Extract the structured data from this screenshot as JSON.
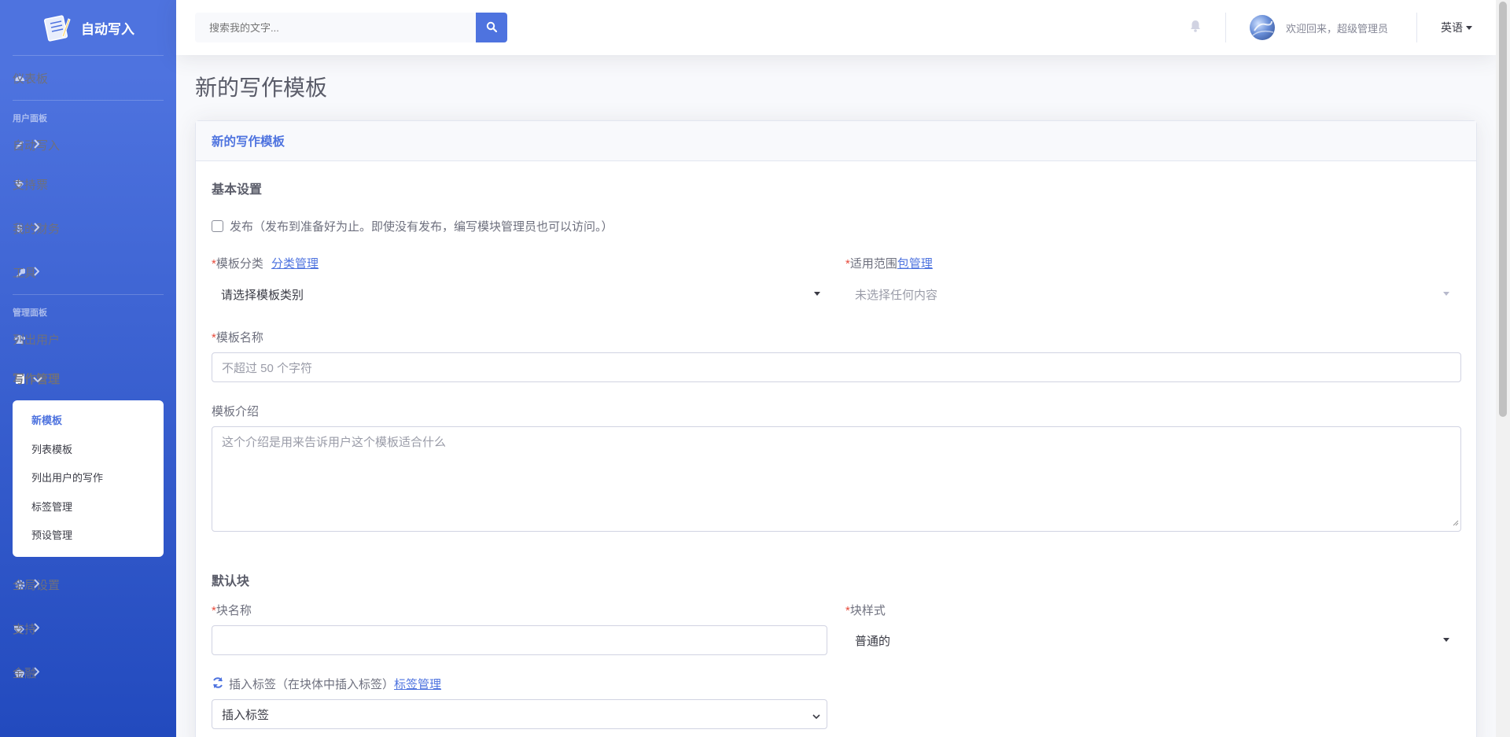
{
  "brand": {
    "name": "自动写入"
  },
  "sidebar": {
    "dashboard": "仪表板",
    "heading_user": "用户面板",
    "auto_write": "自动写入",
    "tickets": "支持票",
    "finance": "我的财务",
    "tools": "工具",
    "heading_admin": "管理面板",
    "list_users": "列出用户",
    "writing_mgmt": "写作管理",
    "sub_items": [
      "新模板",
      "列表模板",
      "列出用户的写作",
      "标签管理",
      "预设管理"
    ],
    "global_settings": "全局设置",
    "support": "支持",
    "finance2": "金融"
  },
  "topbar": {
    "search_placeholder": "搜索我的文字...",
    "welcome": "欢迎回来，超级管理员",
    "language": "英语"
  },
  "page": {
    "title": "新的写作模板",
    "card_title": "新的写作模板",
    "basic_settings": "基本设置",
    "publish_label": "发布（发布到准备好为止。即使没有发布，编写模块管理员也可以访问。）",
    "category_label": "模板分类",
    "category_link": "分类管理",
    "category_value": "请选择模板类别",
    "scope_label": "适用范围",
    "scope_link": "包管理",
    "scope_value": "未选择任何内容",
    "name_label": "模板名称",
    "name_placeholder": "不超过 50 个字符",
    "intro_label": "模板介绍",
    "intro_placeholder": "这个介绍是用来告诉用户这个模板适合什么",
    "default_block": "默认块",
    "block_name_label": "块名称",
    "block_style_label": "块样式",
    "block_style_value": "普通的",
    "insert_tag_label": "插入标签（在块体中插入标签）",
    "insert_tag_link": "标签管理",
    "insert_tag_value": "插入标签"
  },
  "colors": {
    "primary": "#4e73df",
    "danger": "#e74a3b"
  }
}
